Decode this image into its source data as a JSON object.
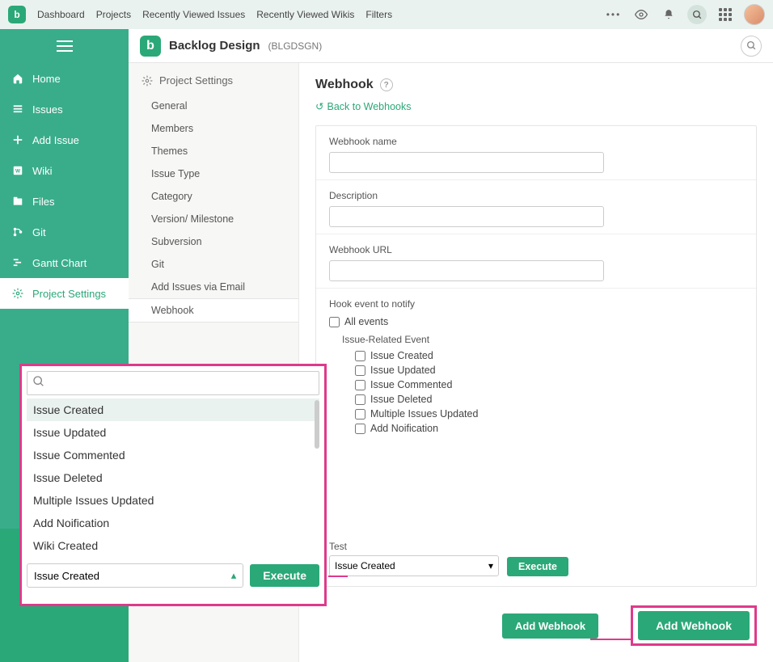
{
  "topnav": {
    "items": [
      "Dashboard",
      "Projects",
      "Recently Viewed Issues",
      "Recently Viewed Wikis",
      "Filters"
    ]
  },
  "sidebar": {
    "items": [
      {
        "icon": "home",
        "label": "Home"
      },
      {
        "icon": "list",
        "label": "Issues"
      },
      {
        "icon": "plus",
        "label": "Add Issue"
      },
      {
        "icon": "wiki",
        "label": "Wiki"
      },
      {
        "icon": "files",
        "label": "Files"
      },
      {
        "icon": "git",
        "label": "Git"
      },
      {
        "icon": "gantt",
        "label": "Gantt Chart"
      },
      {
        "icon": "gear",
        "label": "Project Settings"
      }
    ]
  },
  "project": {
    "name": "Backlog Design",
    "key": "(BLGDSGN)"
  },
  "settings_menu": {
    "title": "Project Settings",
    "items": [
      "General",
      "Members",
      "Themes",
      "Issue Type",
      "Category",
      "Version/ Milestone",
      "Subversion",
      "Git",
      "Add Issues via Email",
      "Webhook"
    ]
  },
  "page": {
    "title": "Webhook",
    "back": "Back to Webhooks",
    "fields": {
      "name_label": "Webhook name",
      "desc_label": "Description",
      "url_label": "Webhook URL",
      "hook_label": "Hook event to notify",
      "all_events": "All events",
      "issue_group": "Issue-Related Event",
      "events": [
        "Issue Created",
        "Issue Updated",
        "Issue Commented",
        "Issue Deleted",
        "Multiple Issues Updated",
        "Add Noification"
      ]
    },
    "test": {
      "label": "Test",
      "selected": "Issue Created",
      "execute": "Execute"
    },
    "add_btn": "Add Webhook"
  },
  "dropdown": {
    "search_value": "",
    "items": [
      "Issue Created",
      "Issue Updated",
      "Issue Commented",
      "Issue Deleted",
      "Multiple Issues Updated",
      "Add Noification",
      "Wiki Created"
    ],
    "selected": "Issue Created",
    "execute": "Execute"
  }
}
